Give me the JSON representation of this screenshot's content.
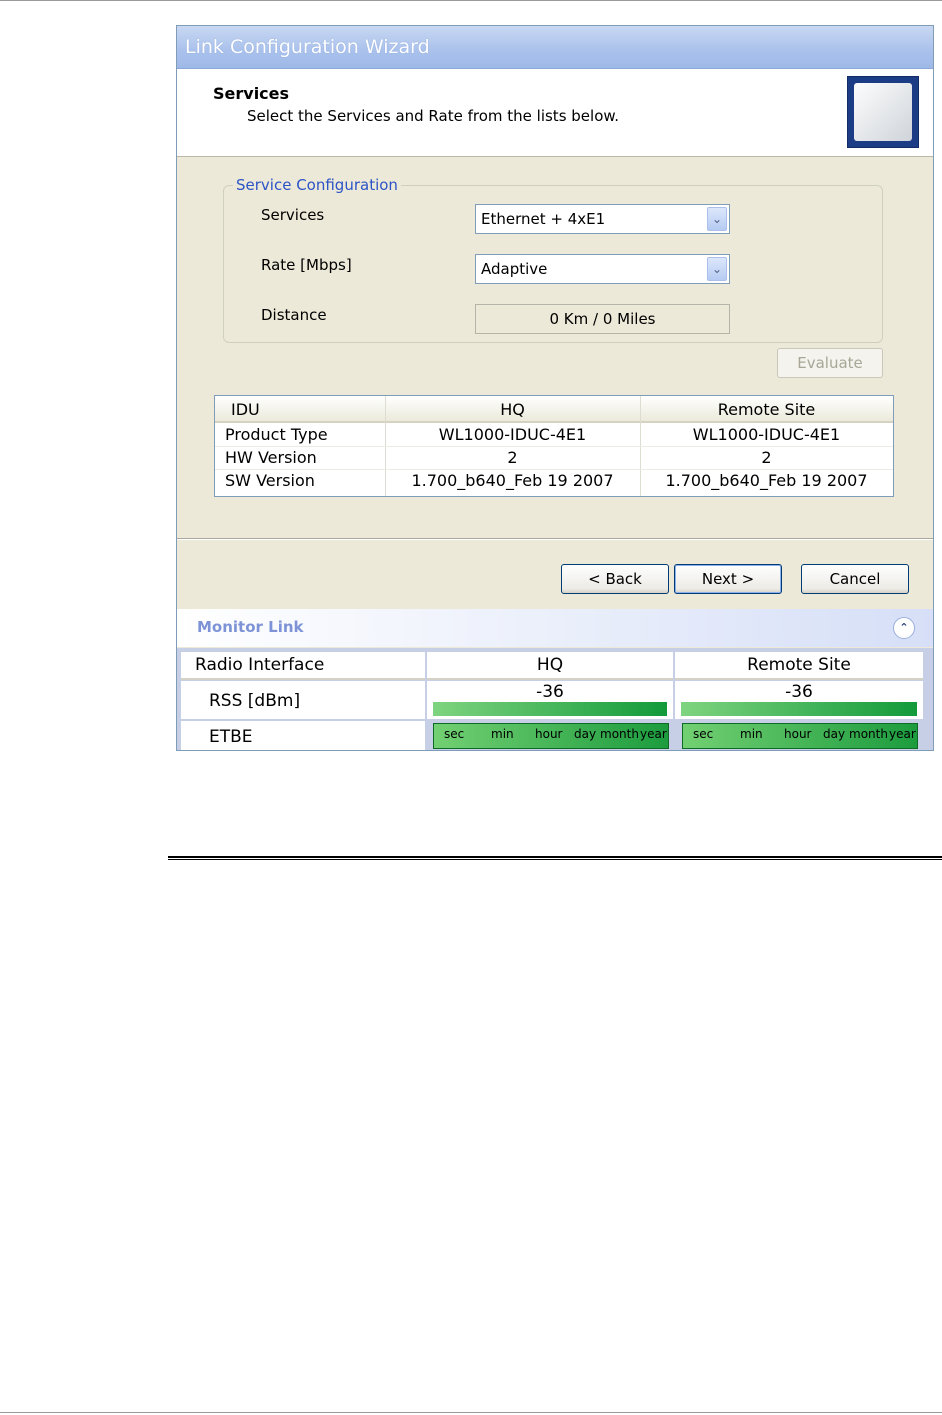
{
  "window": {
    "title": "Link Configuration Wizard"
  },
  "header": {
    "title": "Services",
    "subtitle": "Select the Services and Rate from the lists below."
  },
  "service_configuration": {
    "legend": "Service Configuration",
    "services": {
      "label": "Services",
      "value": "Ethernet + 4xE1"
    },
    "rate": {
      "label": "Rate [Mbps]",
      "value": "Adaptive"
    },
    "distance": {
      "label": "Distance",
      "value": "0 Km / 0 Miles"
    },
    "evaluate_label": "Evaluate"
  },
  "idu_table": {
    "columns": [
      "IDU",
      "HQ",
      "Remote Site"
    ],
    "rows": [
      [
        "Product Type",
        "WL1000-IDUC-4E1",
        "WL1000-IDUC-4E1"
      ],
      [
        "HW Version",
        "2",
        "2"
      ],
      [
        "SW Version",
        "1.700_b640_Feb 19 2007",
        "1.700_b640_Feb 19 2007"
      ]
    ]
  },
  "buttons": {
    "back": "< Back",
    "next": "Next >",
    "cancel": "Cancel"
  },
  "monitor": {
    "title": "Monitor Link",
    "columns": [
      "Radio Interface",
      "HQ",
      "Remote Site"
    ],
    "rss": {
      "label": "RSS [dBm]",
      "hq": "-36",
      "remote": "-36"
    },
    "etbe": {
      "label": "ETBE"
    },
    "scale": [
      "sec",
      "min",
      "hour",
      "day",
      "month",
      "year"
    ]
  },
  "colors": {
    "title_accent": "#2c53c7",
    "monitor_title": "#7d93d6",
    "bar_green_dark": "#129a3a",
    "bar_green_light": "#7fd47f"
  }
}
